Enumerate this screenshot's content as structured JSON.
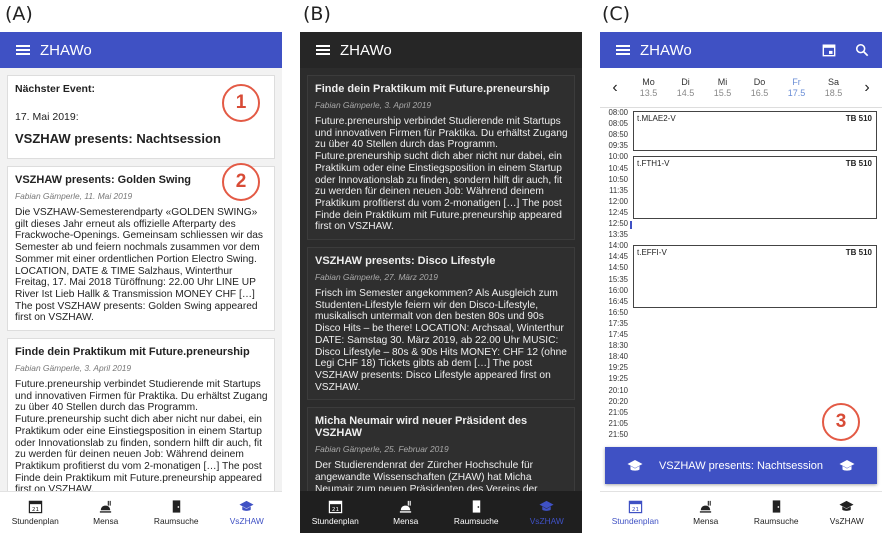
{
  "panel_labels": [
    "(A)",
    "(B)",
    "(C)"
  ],
  "app_title": "ZHAWo",
  "colors": {
    "primary": "#3f51c4",
    "dark_bar": "#262626",
    "dark_bg": "#2c2c2c",
    "badge": "#e35a45"
  },
  "panelA": {
    "next_event": {
      "label": "Nächster Event:",
      "date": "17. Mai 2019:",
      "title": "VSZHAW presents: Nachtsession"
    },
    "posts": [
      {
        "title": "VSZHAW presents: Golden Swing",
        "meta": "Fabian Gämperle, 11. Mai 2019",
        "body": "Die VSZHAW-Semesterendparty «GOLDEN SWING» gilt dieses Jahr erneut als offizielle Afterparty des Frackwoche-Openings. Gemeinsam schliessen wir das Semester ab und feiern nochmals zusammen vor dem Sommer mit einer ordentlichen Portion Electro Swing. LOCATION, DATE & TIME Salzhaus, Winterthur Freitag, 17. Mai 2018 Türöffnung: 22.00 Uhr LINE UP River Ist Lieb Hallk & Transmission MONEY CHF […] The post VSZHAW presents: Golden Swing appeared first on VSZHAW."
      },
      {
        "title": "Finde dein Praktikum mit Future.preneurship",
        "meta": "Fabian Gämperle, 3. April 2019",
        "body": "Future.preneurship verbindet Studierende mit Startups und innovativen Firmen für Praktika. Du erhältst Zugang zu über 40 Stellen durch das Programm. Future.preneurship sucht dich aber nicht nur dabei, ein Praktikum oder eine Einstiegsposition in einem Startup oder Innovationslab zu finden, sondern hilft dir auch, fit zu werden für deinen neuen Job: Während deinem Praktikum profitierst du vom 2-monatigen […] The post Finde dein Praktikum mit Future.preneurship appeared first on VSZHAW."
      }
    ],
    "badges": [
      "1",
      "2"
    ]
  },
  "panelB": {
    "posts": [
      {
        "title": "Finde dein Praktikum mit Future.preneurship",
        "meta": "Fabian Gämperle, 3. April 2019",
        "body": "Future.preneurship verbindet Studierende mit Startups und innovativen Firmen für Praktika. Du erhältst Zugang zu über 40 Stellen durch das Programm. Future.preneurship sucht dich aber nicht nur dabei, ein Praktikum oder eine Einstiegsposition in einem Startup oder Innovationslab zu finden, sondern hilft dir auch, fit zu werden für deinen neuen Job: Während deinem Praktikum profitierst du vom 2-monatigen […] The post Finde dein Praktikum mit Future.preneurship appeared first on VSZHAW."
      },
      {
        "title": "VSZHAW presents: Disco Lifestyle",
        "meta": "Fabian Gämperle, 27. März 2019",
        "body": "Frisch im Semester angekommen? Als Ausgleich zum Studenten-Lifestyle feiern wir den Disco-Lifestyle, musikalisch untermalt von den besten 80s und 90s Disco Hits – be there! LOCATION: Archsaal, Winterthur DATE: Samstag 30. März 2019, ab 22.00 Uhr MUSIC: Disco Lifestyle – 80s & 90s Hits MONEY: CHF 12 (ohne Legi CHF 18) Tickets gibts ab dem […] The post VSZHAW presents: Disco Lifestyle appeared first on VSZHAW."
      },
      {
        "title": "Micha Neumair wird neuer Präsident des VSZHAW",
        "meta": "Fabian Gämperle, 25. Februar 2019",
        "body": "Der Studierendenrat der Zürcher Hochschule für angewandte Wissenschaften (ZHAW) hat Micha Neumair zum neuen Präsidenten des Vereins der Studierenden der ZHAW gewählt. Der Wirtschaftsinformatik-Student wird das Amt"
      }
    ]
  },
  "panelC": {
    "days": [
      {
        "name": "Mo",
        "date": "13.5"
      },
      {
        "name": "Di",
        "date": "14.5"
      },
      {
        "name": "Mi",
        "date": "15.5"
      },
      {
        "name": "Do",
        "date": "16.5"
      },
      {
        "name": "Fr",
        "date": "17.5",
        "selected": true
      },
      {
        "name": "Sa",
        "date": "18.5"
      }
    ],
    "prev_icon": "‹",
    "next_icon": "›",
    "times": [
      "08:00",
      "08:05",
      "08:50",
      "09:35",
      "10:00",
      "10:45",
      "10:50",
      "11:35",
      "12:00",
      "12:45",
      "12:50",
      "13:35",
      "14:00",
      "14:45",
      "14:50",
      "15:35",
      "16:00",
      "16:45",
      "16:50",
      "17:35",
      "17:45",
      "18:30",
      "18:40",
      "19:25",
      "19:25",
      "20:10",
      "20:20",
      "21:05",
      "21:05",
      "21:50"
    ],
    "events": [
      {
        "name": "t.MLAE2-V",
        "room": "TB 510"
      },
      {
        "name": "t.FTH1-V",
        "room": "TB 510"
      },
      {
        "name": "t.EFFI-V",
        "room": "TB 510"
      }
    ],
    "snackbar": "VSZHAW presents: Nachtsession",
    "badge": "3"
  },
  "nav": [
    {
      "label": "Stundenplan",
      "icon": "calendar-21-icon"
    },
    {
      "label": "Mensa",
      "icon": "food-tray-icon"
    },
    {
      "label": "Raumsuche",
      "icon": "door-icon"
    },
    {
      "label": "VsZHAW",
      "icon": "graduation-cap-icon"
    }
  ]
}
